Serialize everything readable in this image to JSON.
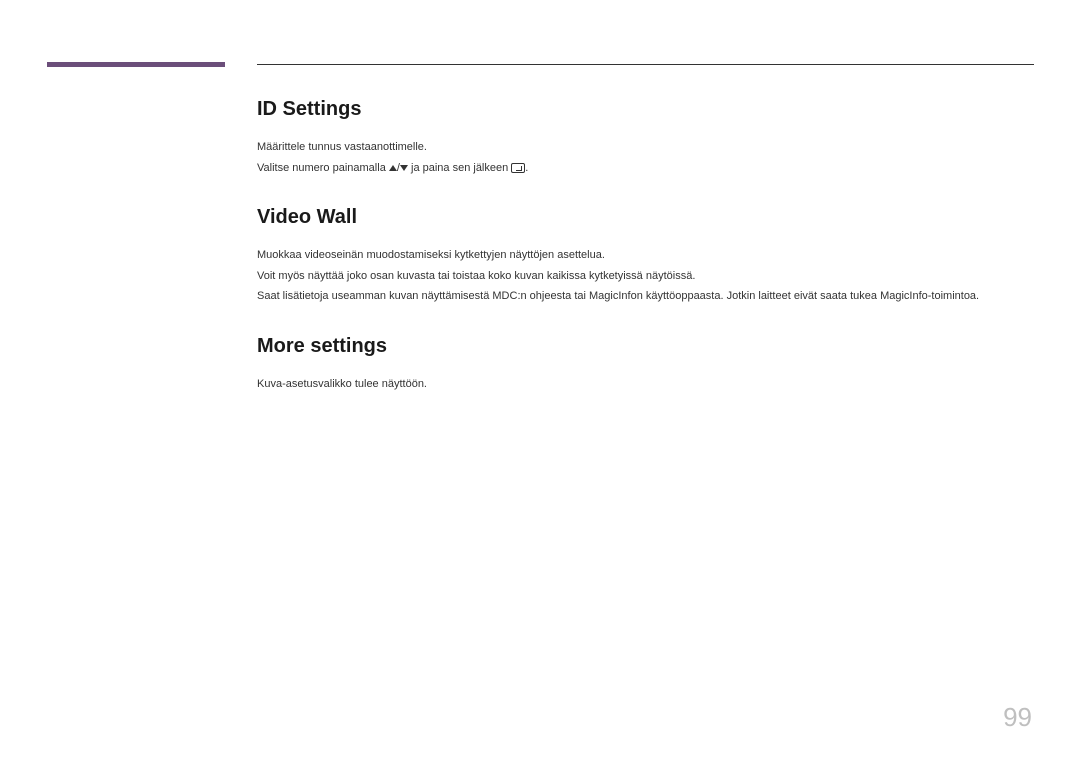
{
  "sections": {
    "id_settings": {
      "heading": "ID Settings",
      "line1": "Määrittele tunnus vastaanottimelle.",
      "line2_part1": "Valitse numero painamalla ",
      "line2_sep": "/",
      "line2_part2": " ja paina sen jälkeen ",
      "line2_end": "."
    },
    "video_wall": {
      "heading": "Video Wall",
      "line1": "Muokkaa videoseinän muodostamiseksi kytkettyjen näyttöjen asettelua.",
      "line2": "Voit myös näyttää joko osan kuvasta tai toistaa koko kuvan kaikissa kytketyissä näytöissä.",
      "line3": "Saat lisätietoja useamman kuvan näyttämisestä MDC:n ohjeesta tai MagicInfon käyttöoppaasta. Jotkin laitteet eivät saata tukea MagicInfo-toimintoa."
    },
    "more_settings": {
      "heading": "More settings",
      "line1": "Kuva-asetusvalikko tulee näyttöön."
    }
  },
  "page_number": "99"
}
